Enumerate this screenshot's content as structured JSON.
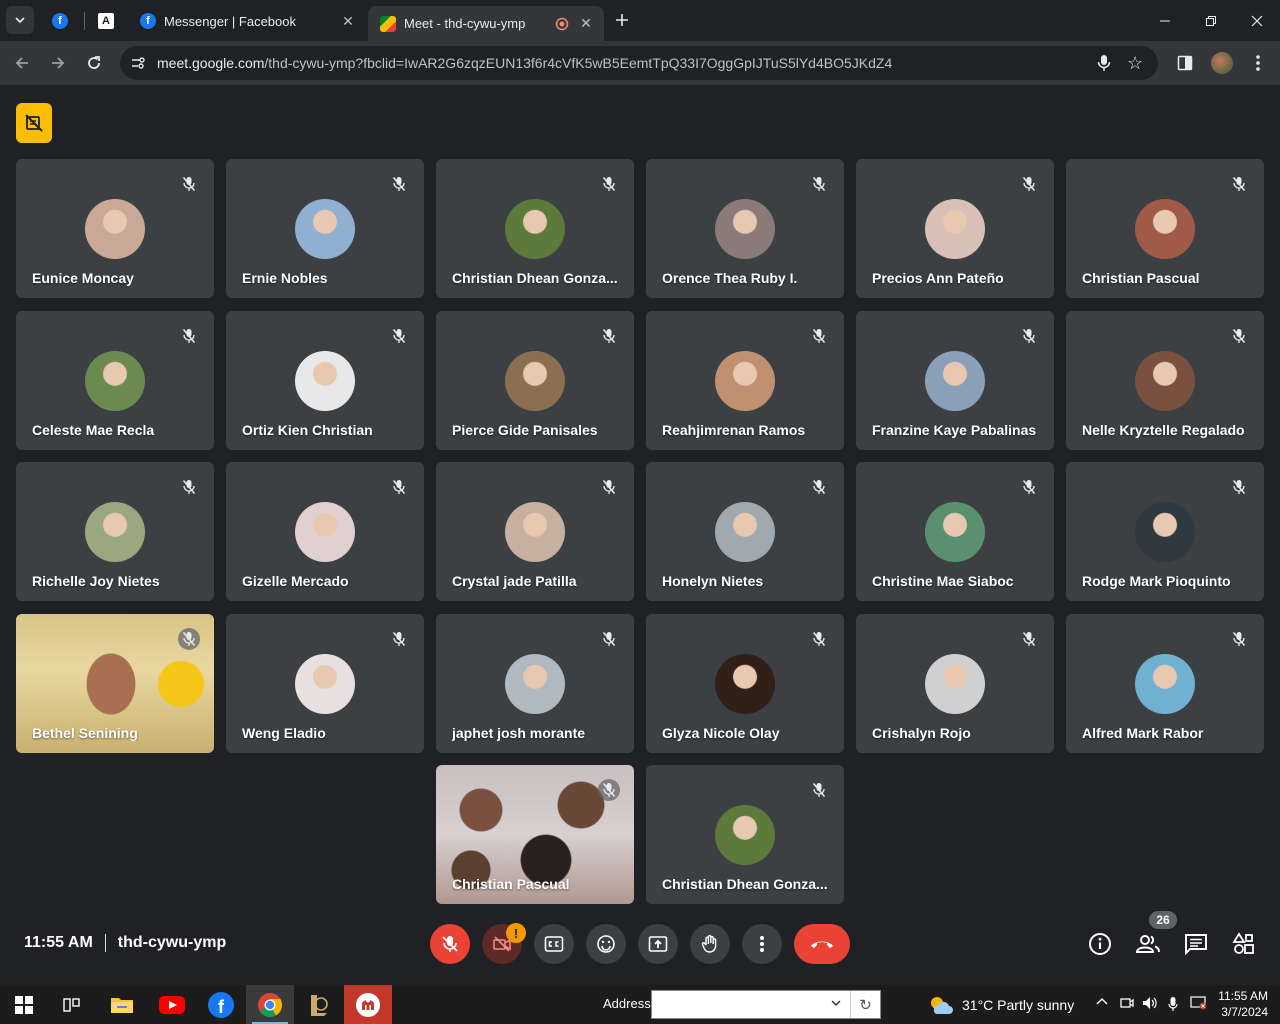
{
  "browser": {
    "tabs": [
      {
        "label": "",
        "icon": "facebook-icon"
      },
      {
        "label": "",
        "icon": "adobe-icon"
      },
      {
        "label": "Messenger | Facebook",
        "icon": "facebook-icon"
      },
      {
        "label": "Meet - thd-cywu-ymp",
        "icon": "google-meet-icon",
        "active": true
      }
    ],
    "url_host": "meet.google.com",
    "url_path": "/thd-cywu-ymp?fbclid=IwAR2G6zqzEUN13f6r4cVfK5wB5EemtTpQ33I7OggGpIJTuS5lYd4BO5JKdZ4"
  },
  "meet": {
    "participants": [
      {
        "name": "Eunice Moncay",
        "avatar_color": "#c9a898"
      },
      {
        "name": "Ernie Nobles",
        "avatar_color": "#8fb0d0"
      },
      {
        "name": "Christian Dhean Gonza...",
        "avatar_color": "#5c7a3a"
      },
      {
        "name": "Orence Thea Ruby I.",
        "avatar_color": "#8a7a78"
      },
      {
        "name": "Precios Ann Pateño",
        "avatar_color": "#d8c0b8"
      },
      {
        "name": "Christian Pascual",
        "avatar_color": "#a05a48"
      },
      {
        "name": "Celeste Mae Recla",
        "avatar_color": "#6a8a50"
      },
      {
        "name": "Ortiz Kien Christian",
        "avatar_color": "#e8e8e8"
      },
      {
        "name": "Pierce Gide Panisales",
        "avatar_color": "#8a7050"
      },
      {
        "name": "Reahjimrenan Ramos",
        "avatar_color": "#c09070"
      },
      {
        "name": "Franzine Kaye Pabalinas",
        "avatar_color": "#8aa0b8"
      },
      {
        "name": "Nelle Kryztelle Regalado",
        "avatar_color": "#7a5040"
      },
      {
        "name": "Richelle Joy Nietes",
        "avatar_color": "#9aa880"
      },
      {
        "name": "Gizelle Mercado",
        "avatar_color": "#e0d0d0"
      },
      {
        "name": "Crystal jade Patilla",
        "avatar_color": "#c8b0a0"
      },
      {
        "name": "Honelyn Nietes",
        "avatar_color": "#a0a8b0"
      },
      {
        "name": "Christine Mae Siaboc",
        "avatar_color": "#5a9070"
      },
      {
        "name": "Rodge Mark Pioquinto",
        "avatar_color": "#303840"
      },
      {
        "name": "Bethel Senining",
        "video": true
      },
      {
        "name": "Weng Eladio",
        "avatar_color": "#e8e0e0"
      },
      {
        "name": "japhet josh morante",
        "avatar_color": "#b0b8c0"
      },
      {
        "name": "Glyza Nicole Olay",
        "avatar_color": "#302018"
      },
      {
        "name": "Crishalyn Rojo",
        "avatar_color": "#d0d0d0"
      },
      {
        "name": "Alfred Mark Rabor",
        "avatar_color": "#70b0d0"
      },
      {
        "name": "Christian Pascual",
        "video": true
      },
      {
        "name": "Christian Dhean Gonza...",
        "avatar_color": "#5c7a3a"
      }
    ],
    "time": "11:55 AM",
    "meeting_code": "thd-cywu-ymp",
    "participant_count": "26",
    "camera_warning": "!"
  },
  "taskbar": {
    "address_label": "Address",
    "weather": "31°C  Partly sunny",
    "time": "11:55 AM",
    "date": "3/7/2024"
  },
  "colors": {
    "meet_bg": "#202124",
    "tile_bg": "#3c4043",
    "mic_red": "#ea4335",
    "badge_yellow": "#fbbc04"
  }
}
